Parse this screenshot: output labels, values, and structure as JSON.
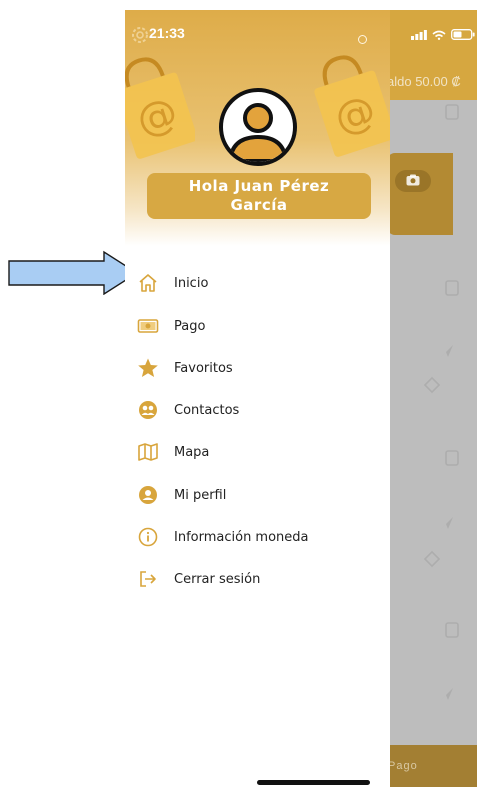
{
  "status_bar": {
    "time": "21:33"
  },
  "background": {
    "balance_label": "aldo 50.00 ₡",
    "footer_label": "Pago"
  },
  "drawer": {
    "greeting": "Hola Juan Pérez García",
    "menu": [
      {
        "label": "Inicio",
        "icon": "home-icon"
      },
      {
        "label": "Pago",
        "icon": "cash-icon"
      },
      {
        "label": "Favoritos",
        "icon": "star-icon"
      },
      {
        "label": "Contactos",
        "icon": "contacts-icon"
      },
      {
        "label": "Mapa",
        "icon": "map-icon"
      },
      {
        "label": "Mi perfil",
        "icon": "user-circle-icon"
      },
      {
        "label": "Información moneda",
        "icon": "info-icon"
      },
      {
        "label": "Cerrar sesión",
        "icon": "logout-icon"
      }
    ]
  },
  "colors": {
    "accent": "#d7a843",
    "icon": "#d8a53c",
    "annotation_arrow": "#a9cdf3"
  }
}
